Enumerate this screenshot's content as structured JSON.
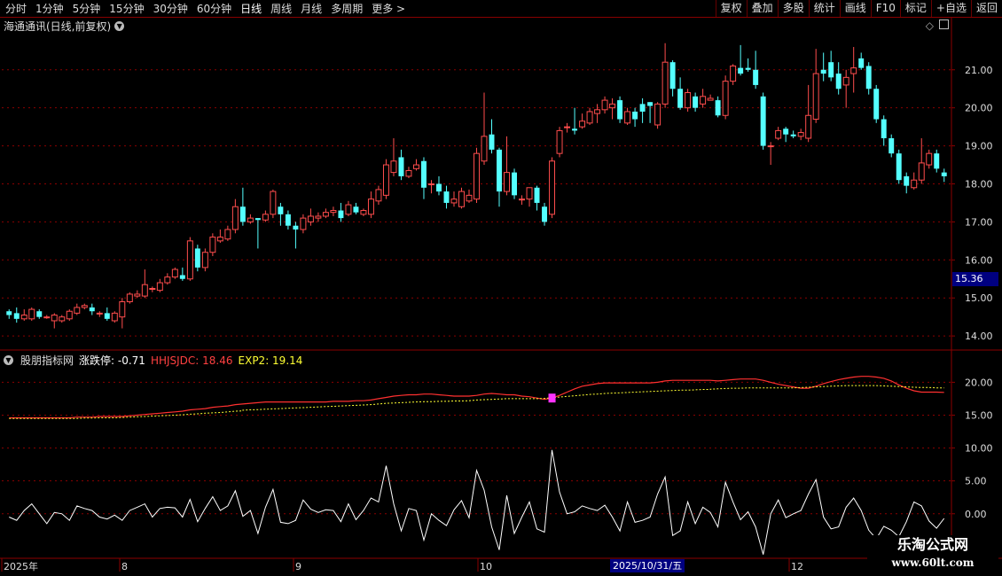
{
  "toolbar": {
    "periods": [
      "分时",
      "1分钟",
      "5分钟",
      "15分钟",
      "30分钟",
      "60分钟",
      "日线",
      "周线",
      "月线",
      "多周期",
      "更多 >"
    ],
    "active_period": "日线",
    "actions": [
      "复权",
      "叠加",
      "多股",
      "统计",
      "画线",
      "F10",
      "标记",
      "+自选",
      "返回"
    ]
  },
  "stock": {
    "name": "海通通讯",
    "title": "海通通讯(日线,前复权)"
  },
  "indicator": {
    "name": "股朋指标网",
    "zdt_label": "涨跌停: -0.71",
    "hhsjdc_label": "HHJSJDC: 18.46",
    "exp2_label": "EXP2: 19.14"
  },
  "price_tag": "15.36",
  "date_tag": "2025/10/31/五",
  "x_labels": [
    "2025年",
    "8",
    "9",
    "10",
    "12"
  ],
  "watermark": {
    "line1": "乐淘公式网",
    "line2": "www.60lt.com"
  },
  "colors": {
    "up": "#ff4d4d",
    "down": "#54ffff",
    "ma": "#ff3030",
    "exp": "#ffff33",
    "osc": "#ffffff",
    "marker": "#ff33ff",
    "grid": "#8b0000"
  },
  "chart_data": [
    {
      "type": "candlestick",
      "yaxis_ticks": [
        "14.00",
        "15.00",
        "16.00",
        "17.00",
        "18.00",
        "19.00",
        "20.00",
        "21.00"
      ],
      "ylim": [
        13.7,
        21.95
      ],
      "candles": [
        [
          14.65,
          14.55,
          14.7,
          14.45
        ],
        [
          14.6,
          14.45,
          14.75,
          14.35
        ],
        [
          14.45,
          14.55,
          14.7,
          14.4
        ],
        [
          14.45,
          14.7,
          14.75,
          14.4
        ],
        [
          14.65,
          14.5,
          14.7,
          14.45
        ],
        [
          14.5,
          14.5,
          14.55,
          14.45
        ],
        [
          14.4,
          14.55,
          14.6,
          14.2
        ],
        [
          14.4,
          14.5,
          14.55,
          14.35
        ],
        [
          14.45,
          14.65,
          14.7,
          14.4
        ],
        [
          14.6,
          14.75,
          14.85,
          14.55
        ],
        [
          14.75,
          14.8,
          14.85,
          14.7
        ],
        [
          14.75,
          14.65,
          14.85,
          14.55
        ],
        [
          14.6,
          14.6,
          14.65,
          14.5
        ],
        [
          14.6,
          14.45,
          14.75,
          14.4
        ],
        [
          14.4,
          14.6,
          14.65,
          14.35
        ],
        [
          14.5,
          14.9,
          15.0,
          14.2
        ],
        [
          14.9,
          15.1,
          15.15,
          14.85
        ],
        [
          15.05,
          15.1,
          15.2,
          15.0
        ],
        [
          15.05,
          15.35,
          15.75,
          15.0
        ],
        [
          15.25,
          15.25,
          15.3,
          15.15
        ],
        [
          15.2,
          15.4,
          15.5,
          15.15
        ],
        [
          15.4,
          15.55,
          15.65,
          15.35
        ],
        [
          15.55,
          15.75,
          15.8,
          15.5
        ],
        [
          15.6,
          15.5,
          15.8,
          15.45
        ],
        [
          15.5,
          16.5,
          16.6,
          15.45
        ],
        [
          16.3,
          15.8,
          16.4,
          15.7
        ],
        [
          15.8,
          16.2,
          16.3,
          15.7
        ],
        [
          16.2,
          16.6,
          16.7,
          16.1
        ],
        [
          16.5,
          16.6,
          16.8,
          16.45
        ],
        [
          16.55,
          16.8,
          16.9,
          16.5
        ],
        [
          16.8,
          17.4,
          17.6,
          16.7
        ],
        [
          17.4,
          17.0,
          17.9,
          16.9
        ],
        [
          17.0,
          17.1,
          17.2,
          16.95
        ],
        [
          17.1,
          17.05,
          17.1,
          16.3
        ],
        [
          17.05,
          17.2,
          17.3,
          17.0
        ],
        [
          17.2,
          17.8,
          17.85,
          17.1
        ],
        [
          17.4,
          17.2,
          17.5,
          16.9
        ],
        [
          17.2,
          16.9,
          17.3,
          16.8
        ],
        [
          16.9,
          16.8,
          17.0,
          16.3
        ],
        [
          16.8,
          17.1,
          17.2,
          16.7
        ],
        [
          17.0,
          17.15,
          17.35,
          16.9
        ],
        [
          17.1,
          17.15,
          17.25,
          17.0
        ],
        [
          17.15,
          17.25,
          17.35,
          17.1
        ],
        [
          17.25,
          17.3,
          17.4,
          17.15
        ],
        [
          17.3,
          17.1,
          17.5,
          17.0
        ],
        [
          17.2,
          17.45,
          17.55,
          17.15
        ],
        [
          17.4,
          17.25,
          17.5,
          17.2
        ],
        [
          17.2,
          17.3,
          17.35,
          17.15
        ],
        [
          17.2,
          17.6,
          17.8,
          17.1
        ],
        [
          17.55,
          17.85,
          17.95,
          17.45
        ],
        [
          17.7,
          18.5,
          18.65,
          17.6
        ],
        [
          18.3,
          18.6,
          19.2,
          18.2
        ],
        [
          18.7,
          18.2,
          18.9,
          18.1
        ],
        [
          18.2,
          18.35,
          18.45,
          18.15
        ],
        [
          18.4,
          18.5,
          18.65,
          18.35
        ],
        [
          18.6,
          17.9,
          18.7,
          17.6
        ],
        [
          18.0,
          18.0,
          18.1,
          17.75
        ],
        [
          18.0,
          17.8,
          18.2,
          17.7
        ],
        [
          17.8,
          17.5,
          17.95,
          17.35
        ],
        [
          17.5,
          17.6,
          17.8,
          17.4
        ],
        [
          17.4,
          17.8,
          17.9,
          17.35
        ],
        [
          17.55,
          17.7,
          17.85,
          17.5
        ],
        [
          17.6,
          18.8,
          18.95,
          17.5
        ],
        [
          18.6,
          19.25,
          20.4,
          18.5
        ],
        [
          19.3,
          18.9,
          19.7,
          18.8
        ],
        [
          18.9,
          17.8,
          18.95,
          17.4
        ],
        [
          17.8,
          18.3,
          19.25,
          17.7
        ],
        [
          18.3,
          17.7,
          18.4,
          17.6
        ],
        [
          17.6,
          17.6,
          17.7,
          17.45
        ],
        [
          17.6,
          17.9,
          17.9,
          17.4
        ],
        [
          17.9,
          17.5,
          17.95,
          17.3
        ],
        [
          17.4,
          17.0,
          17.5,
          16.9
        ],
        [
          17.2,
          18.6,
          18.7,
          17.1
        ],
        [
          18.8,
          19.4,
          19.5,
          18.7
        ],
        [
          19.5,
          19.5,
          19.6,
          19.35
        ],
        [
          19.45,
          19.4,
          20.0,
          19.3
        ],
        [
          19.5,
          19.65,
          19.85,
          19.45
        ],
        [
          19.6,
          19.9,
          20.0,
          19.55
        ],
        [
          19.85,
          19.95,
          20.1,
          19.6
        ],
        [
          19.95,
          20.2,
          20.3,
          19.85
        ],
        [
          20.0,
          20.1,
          20.25,
          19.7
        ],
        [
          20.2,
          19.7,
          20.3,
          19.6
        ],
        [
          19.6,
          19.9,
          20.0,
          19.55
        ],
        [
          19.9,
          19.7,
          20.0,
          19.5
        ],
        [
          20.1,
          19.9,
          20.25,
          19.6
        ],
        [
          20.15,
          20.05,
          20.15,
          19.6
        ],
        [
          19.55,
          20.1,
          20.15,
          19.45
        ],
        [
          20.1,
          21.2,
          21.7,
          20.0
        ],
        [
          21.2,
          20.5,
          21.25,
          20.3
        ],
        [
          20.5,
          20.0,
          20.8,
          19.95
        ],
        [
          20.0,
          20.4,
          20.5,
          19.9
        ],
        [
          20.3,
          20.0,
          20.4,
          19.9
        ],
        [
          20.1,
          20.3,
          20.5,
          20.0
        ],
        [
          20.2,
          20.25,
          20.35,
          20.2
        ],
        [
          20.2,
          19.8,
          20.3,
          19.75
        ],
        [
          19.8,
          20.7,
          20.85,
          19.7
        ],
        [
          20.7,
          21.1,
          21.15,
          20.6
        ],
        [
          21.05,
          20.9,
          21.65,
          20.85
        ],
        [
          21.05,
          21.0,
          21.3,
          20.95
        ],
        [
          21.0,
          20.6,
          21.5,
          20.5
        ],
        [
          20.3,
          19.0,
          20.4,
          18.9
        ],
        [
          19.0,
          19.0,
          19.1,
          18.5
        ],
        [
          19.2,
          19.4,
          19.5,
          19.15
        ],
        [
          19.45,
          19.3,
          19.5,
          19.1
        ],
        [
          19.3,
          19.25,
          19.4,
          19.2
        ],
        [
          19.25,
          19.35,
          19.45,
          19.15
        ],
        [
          19.2,
          19.8,
          20.6,
          19.1
        ],
        [
          19.7,
          20.9,
          21.55,
          19.6
        ],
        [
          21.0,
          20.9,
          21.45,
          20.7
        ],
        [
          21.2,
          20.8,
          21.5,
          20.7
        ],
        [
          20.9,
          20.5,
          21.2,
          20.35
        ],
        [
          20.6,
          20.8,
          21.0,
          20.0
        ],
        [
          20.9,
          21.05,
          21.6,
          20.4
        ],
        [
          21.3,
          21.05,
          21.45,
          21.0
        ],
        [
          21.1,
          20.5,
          21.2,
          20.35
        ],
        [
          20.5,
          19.7,
          20.6,
          19.6
        ],
        [
          19.7,
          19.2,
          19.8,
          19.0
        ],
        [
          19.2,
          18.8,
          19.3,
          18.7
        ],
        [
          18.8,
          18.1,
          18.9,
          18.0
        ],
        [
          18.2,
          17.95,
          18.3,
          17.75
        ],
        [
          17.9,
          18.1,
          18.3,
          17.85
        ],
        [
          18.1,
          18.55,
          19.2,
          18.0
        ],
        [
          18.5,
          18.8,
          18.9,
          18.4
        ],
        [
          18.8,
          18.4,
          18.9,
          18.3
        ],
        [
          18.3,
          18.2,
          18.4,
          18.05
        ]
      ]
    },
    {
      "type": "line",
      "yaxis_ticks": [
        "20.00",
        "15.00",
        "10.00",
        "5.00",
        "0.00"
      ],
      "ylim": [
        -6.5,
        24.5
      ],
      "series": [
        {
          "name": "HHJSJDC",
          "values": [
            14.6,
            14.6,
            14.6,
            14.6,
            14.6,
            14.6,
            14.6,
            14.6,
            14.6,
            14.7,
            14.7,
            14.7,
            14.8,
            14.8,
            14.8,
            14.8,
            14.9,
            15.0,
            15.1,
            15.2,
            15.3,
            15.4,
            15.5,
            15.6,
            15.8,
            15.9,
            16.0,
            16.2,
            16.3,
            16.4,
            16.6,
            16.7,
            16.8,
            16.9,
            17.0,
            17.0,
            17.0,
            17.0,
            17.0,
            17.0,
            17.0,
            17.0,
            17.0,
            17.1,
            17.1,
            17.1,
            17.2,
            17.2,
            17.3,
            17.5,
            17.7,
            17.9,
            18.0,
            18.1,
            18.1,
            18.2,
            18.2,
            18.1,
            18.0,
            17.9,
            17.9,
            17.9,
            18.0,
            18.2,
            18.3,
            18.2,
            18.1,
            18.1,
            17.9,
            17.8,
            17.6,
            17.4,
            17.6,
            18.0,
            18.5,
            19.0,
            19.4,
            19.6,
            19.8,
            19.9,
            19.9,
            19.9,
            19.9,
            19.9,
            19.9,
            19.9,
            20.0,
            20.2,
            20.3,
            20.3,
            20.3,
            20.3,
            20.3,
            20.3,
            20.2,
            20.3,
            20.4,
            20.5,
            20.5,
            20.5,
            20.3,
            20.0,
            19.7,
            19.5,
            19.3,
            19.1,
            19.1,
            19.4,
            19.8,
            20.1,
            20.4,
            20.6,
            20.8,
            20.9,
            20.9,
            20.8,
            20.6,
            20.2,
            19.6,
            19.1,
            18.7,
            18.5,
            18.5,
            18.5,
            18.46
          ]
        },
        {
          "name": "EXP2",
          "values": [
            14.5,
            14.5,
            14.5,
            14.5,
            14.5,
            14.5,
            14.5,
            14.5,
            14.5,
            14.5,
            14.55,
            14.55,
            14.6,
            14.6,
            14.6,
            14.65,
            14.7,
            14.75,
            14.8,
            14.85,
            14.9,
            14.95,
            15.0,
            15.05,
            15.15,
            15.2,
            15.3,
            15.35,
            15.4,
            15.5,
            15.6,
            15.65,
            15.75,
            15.8,
            15.85,
            15.9,
            15.95,
            16.0,
            16.05,
            16.1,
            16.15,
            16.2,
            16.25,
            16.3,
            16.35,
            16.4,
            16.45,
            16.5,
            16.55,
            16.6,
            16.7,
            16.8,
            16.85,
            16.9,
            16.95,
            17.0,
            17.05,
            17.05,
            17.1,
            17.1,
            17.15,
            17.15,
            17.2,
            17.3,
            17.35,
            17.4,
            17.45,
            17.5,
            17.5,
            17.5,
            17.5,
            17.5,
            17.55,
            17.65,
            17.75,
            17.85,
            17.95,
            18.05,
            18.15,
            18.2,
            18.3,
            18.35,
            18.4,
            18.45,
            18.5,
            18.55,
            18.6,
            18.65,
            18.7,
            18.75,
            18.8,
            18.8,
            18.85,
            18.9,
            18.9,
            18.95,
            19.0,
            19.05,
            19.1,
            19.1,
            19.15,
            19.15,
            19.15,
            19.15,
            19.15,
            19.15,
            19.15,
            19.2,
            19.25,
            19.3,
            19.35,
            19.4,
            19.45,
            19.5,
            19.5,
            19.5,
            19.5,
            19.5,
            19.45,
            19.4,
            19.35,
            19.3,
            19.25,
            19.2,
            19.2,
            19.15,
            19.14
          ]
        },
        {
          "name": "涨跌停",
          "values": [
            -0.5,
            -1.0,
            0.5,
            1.5,
            0,
            -1.5,
            0.2,
            0,
            -1.0,
            1.2,
            0.8,
            0.5,
            -0.5,
            -0.8,
            -0.2,
            -1.0,
            0.5,
            1.0,
            1.5,
            -0.5,
            0.8,
            1.0,
            0.9,
            -0.5,
            2.2,
            -1.2,
            0.8,
            2.6,
            0.5,
            1.2,
            3.5,
            -0.4,
            0.5,
            -3.0,
            1.0,
            3.7,
            -1.3,
            -1.5,
            -1.0,
            2.1,
            0.7,
            0.2,
            0.6,
            0.5,
            -1.2,
            1.5,
            -0.9,
            0.5,
            2.4,
            1.8,
            7.3,
            1.5,
            -2.6,
            0.8,
            0.5,
            -4.0,
            0,
            -1.0,
            -1.8,
            0.6,
            2.0,
            -0.6,
            6.6,
            3.6,
            -2.0,
            -5.5,
            2.8,
            -3.0,
            -0.5,
            1.8,
            -2.3,
            -2.8,
            9.7,
            3.3,
            0,
            0.3,
            1.2,
            0.8,
            0.5,
            1.3,
            -0.5,
            -2.6,
            1.8,
            -1.3,
            -1.0,
            -0.5,
            3.0,
            5.6,
            -3.3,
            -2.6,
            1.8,
            -1.5,
            1.0,
            0.2,
            -2.0,
            4.8,
            1.8,
            -0.9,
            0.3,
            -2.0,
            -6.2,
            0,
            2.1,
            -0.6,
            0,
            0.5,
            3.0,
            5.2,
            -0.5,
            -2.3,
            -2.0,
            1.0,
            2.4,
            0.5,
            -2.5,
            -3.8,
            -1.9,
            -2.5,
            -3.5,
            -1.2,
            1.8,
            1.2,
            -1.1,
            -2.2,
            -0.71
          ]
        }
      ],
      "marker_index": 72
    }
  ]
}
